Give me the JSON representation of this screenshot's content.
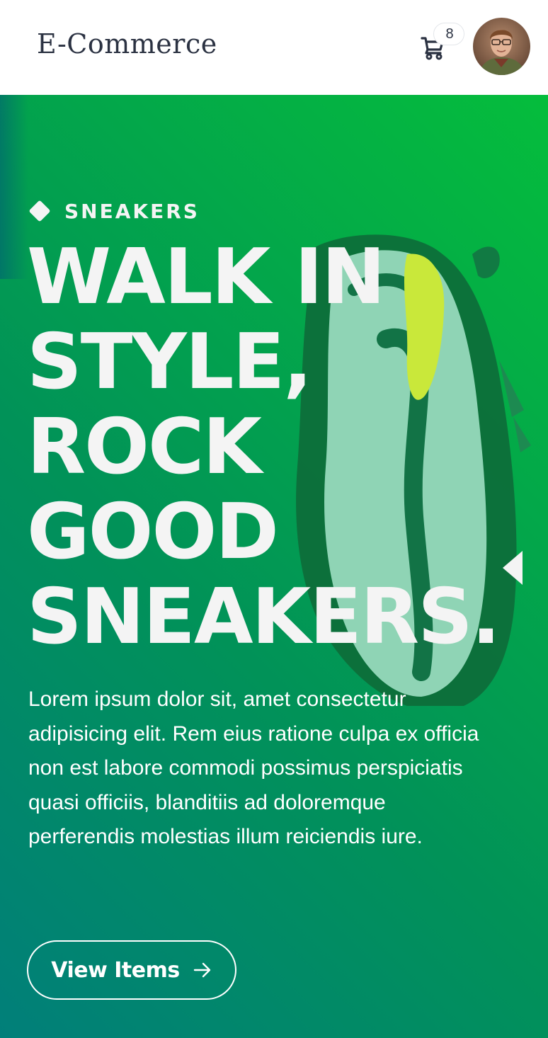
{
  "header": {
    "brand": "E-Commerce",
    "cart_icon": "shopping-cart-icon",
    "cart_count": "8",
    "avatar_alt": "user-avatar"
  },
  "hero": {
    "category": "SNEAKERS",
    "headline_lines": [
      "WALK IN",
      "STYLE,",
      "ROCK",
      "GOOD",
      "SNEAKERS."
    ],
    "description": "Lorem ipsum dolor sit, amet consectetur adipisicing elit. Rem eius ratione culpa ex officia non est labore commodi possimus perspiciatis quasi officiis, blanditiis ad doloremque perferendis molestias illum reiciendis iure.",
    "button_label": "View Items",
    "button_icon": "arrow-right-icon",
    "carousel_icon": "chevron-left-icon",
    "gradient_colors": [
      "#05bd3c",
      "#017f7a"
    ],
    "text_color": "#f4f4f4"
  }
}
